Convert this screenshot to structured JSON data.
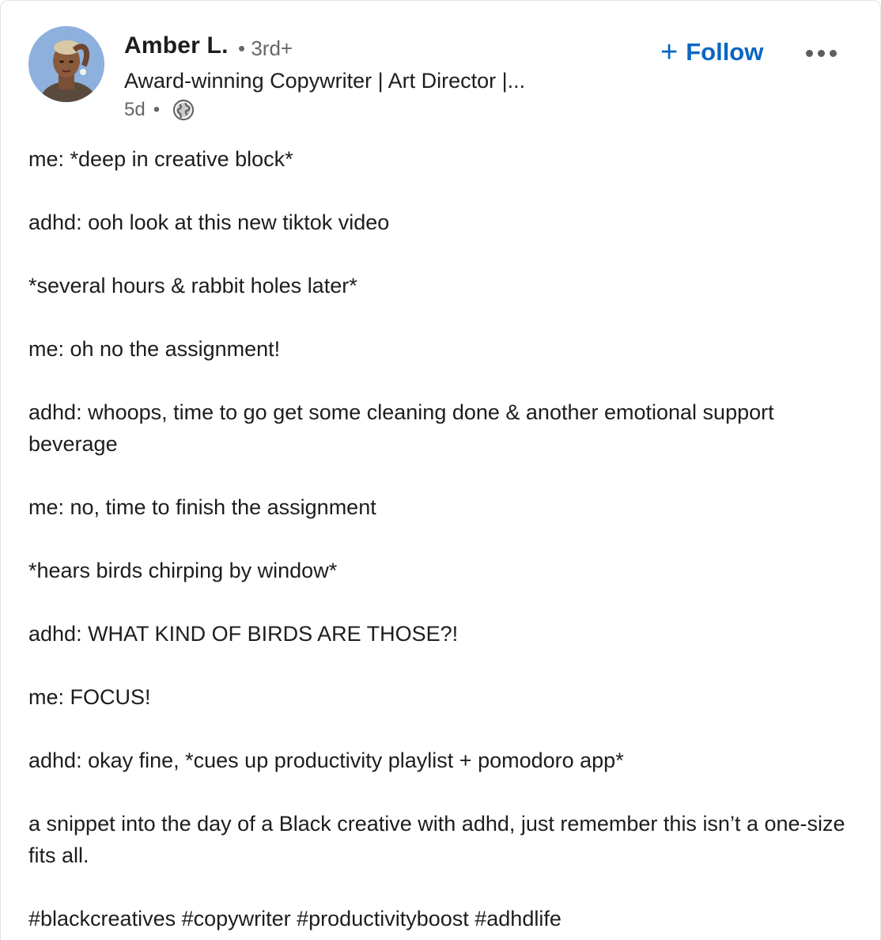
{
  "author": {
    "name": "Amber L.",
    "degree": "3rd+",
    "headline": "Award-winning Copywriter | Art Director |...",
    "timestamp": "5d",
    "visibility_icon": "globe-icon"
  },
  "actions": {
    "follow_label": "Follow",
    "follow_icon": "plus-icon",
    "more_icon": "more-options-icon"
  },
  "post": {
    "lines": [
      "me: *deep in creative block*",
      "adhd: ooh look at this new tiktok video",
      "*several hours & rabbit holes later*",
      "me: oh no the assignment!",
      "adhd: whoops, time to go get some cleaning done & another emotional support beverage",
      "me: no, time to finish the assignment",
      "*hears birds chirping by window*",
      "adhd: WHAT KIND OF BIRDS ARE THOSE?!",
      "me: FOCUS!",
      "adhd: okay fine, *cues up productivity playlist + pomodoro app*",
      "a snippet into the day of a Black creative with adhd, just remember this isn’t a one-size fits all."
    ],
    "hashtags": "#blackcreatives #copywriter #productivityboost #adhdlife"
  },
  "colors": {
    "accent": "#0a66c2",
    "muted_text": "#666666",
    "primary_text": "#1d1d1d"
  }
}
